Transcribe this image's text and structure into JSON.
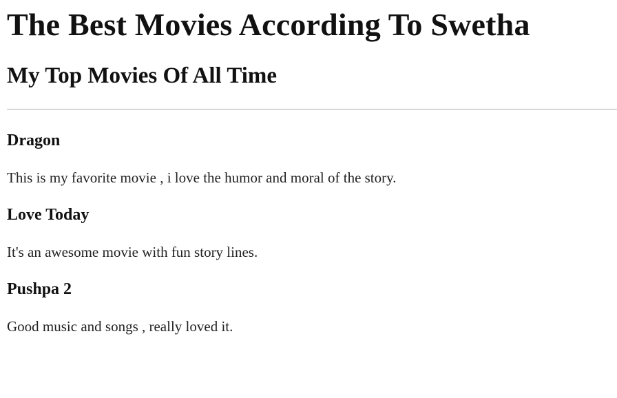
{
  "page": {
    "title": "The Best Movies According To Swetha",
    "subtitle": "My Top Movies Of All Time"
  },
  "movies": [
    {
      "title": "Dragon",
      "description": "This is my favorite movie , i love the humor and moral of the story."
    },
    {
      "title": "Love Today",
      "description": "It's an awesome movie with fun story lines."
    },
    {
      "title": "Pushpa 2",
      "description": "Good music and songs , really loved it."
    }
  ]
}
